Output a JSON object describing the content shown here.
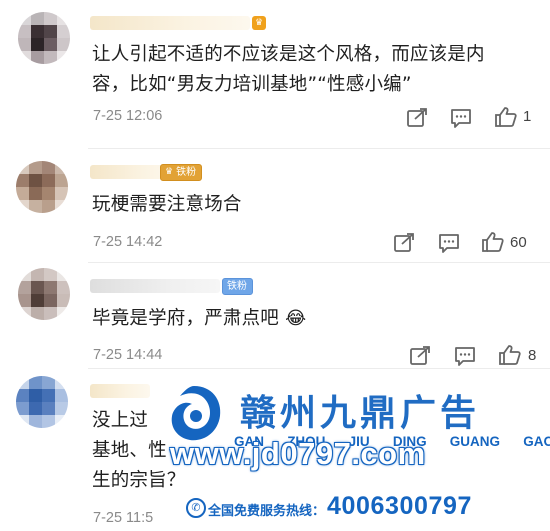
{
  "comments": [
    {
      "text_lines": [
        "让人引起不适的不应该是这个风格，而应该是内",
        "容，比如“男友力培训基地”“性感小编”"
      ],
      "time": "7-25 12:06",
      "likes": "1",
      "badge": null
    },
    {
      "text_lines": [
        "玩梗需要注意场合"
      ],
      "time": "7-25 14:42",
      "likes": "60",
      "badge": "铁粉"
    },
    {
      "text_lines": [
        "毕竟是学府，严肃点吧"
      ],
      "emoji": "😂",
      "time": "7-25 14:44",
      "likes": "8",
      "badge": "铁粉"
    },
    {
      "text_lines": [
        "没上过",
        "基地、性",
        "生的宗旨？"
      ],
      "time": "7-25 11:5",
      "likes": "",
      "badge": null
    }
  ],
  "icons": {
    "share": "share-icon",
    "comment": "comment-icon",
    "like": "thumbs-up-icon"
  },
  "watermark": {
    "brand_cn": "赣州九鼎广告",
    "pinyin": [
      "GAN",
      "ZHOU",
      "JIU",
      "DING",
      "GUANG",
      "GAO"
    ],
    "url": "www.jd0797.com",
    "hotline_label": "全国免费服务热线：",
    "phone": "4006300797",
    "color": "#1565c0"
  },
  "colors": {
    "text": "#1f1f1f",
    "meta": "#8a8a8a",
    "fan_gold": "#e2a235",
    "fan_blue": "#6fa6e8"
  }
}
